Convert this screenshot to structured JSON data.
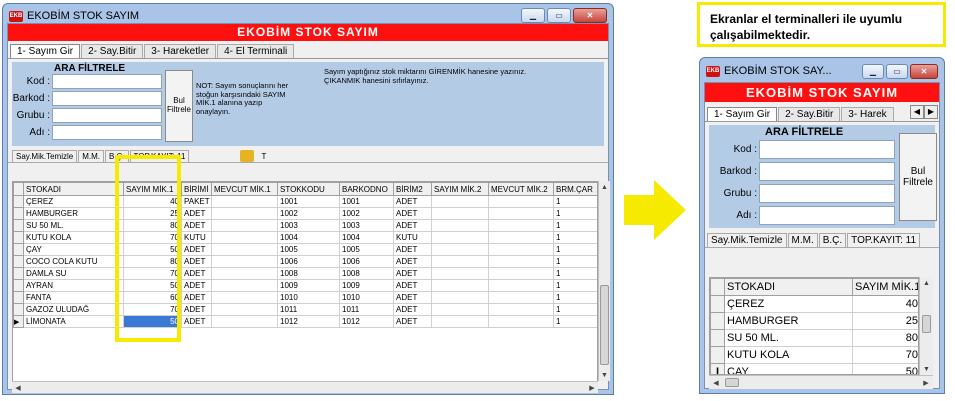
{
  "desktop": {
    "window_title": "EKOBİM STOK SAYIM",
    "app_icon_text": "EKB",
    "banner": "EKOBİM STOK SAYIM",
    "tabs": [
      {
        "label": "1- Sayım Gir"
      },
      {
        "label": "2- Say.Bitir"
      },
      {
        "label": "3- Hareketler"
      },
      {
        "label": "4- El Terminali"
      }
    ],
    "filter": {
      "title": "ARA FİLTRELE",
      "fields": [
        {
          "label": "Kod :",
          "value": ""
        },
        {
          "label": "Barkod :",
          "value": ""
        },
        {
          "label": "Grubu :",
          "value": ""
        },
        {
          "label": "Adı :",
          "value": ""
        }
      ],
      "button_label": "Bul\nFiltrele",
      "note": "NOT: Sayım sonuçlarını her stoğun karşısındaki SAYIM MİK.1 alanına yazıp onaylayın.",
      "info": "Sayım yaptığınız stok miktarını GİRENMİK hanesine yazınız. ÇIKANMIK hanesini sıfırlayınız."
    },
    "status": {
      "clear": "Say.Mik.Temizle",
      "mm": "M.M.",
      "bc": "B.Ç.",
      "total": "TOP.KAYIT: 11",
      "t": "T"
    },
    "columns": [
      "STOKADI",
      "SAYIM MİK.1",
      "BİRİMİ",
      "MEVCUT MİK.1",
      "STOKKODU",
      "BARKODNO",
      "BİRİM2",
      "SAYIM MİK.2",
      "MEVCUT MİK.2",
      "BRM.ÇAR"
    ],
    "rows": [
      {
        "name": "ÇEREZ",
        "qty": "40",
        "unit": "PAKET",
        "stock": "",
        "code": "1001",
        "barcode": "1001",
        "unit2": "ADET",
        "qty2": "",
        "stock2": "",
        "factor": "1"
      },
      {
        "name": "HAMBURGER",
        "qty": "25",
        "unit": "ADET",
        "stock": "",
        "code": "1002",
        "barcode": "1002",
        "unit2": "ADET",
        "qty2": "",
        "stock2": "",
        "factor": "1"
      },
      {
        "name": "SU 50 ML.",
        "qty": "80",
        "unit": "ADET",
        "stock": "",
        "code": "1003",
        "barcode": "1003",
        "unit2": "ADET",
        "qty2": "",
        "stock2": "",
        "factor": "1"
      },
      {
        "name": "KUTU KOLA",
        "qty": "70",
        "unit": "KUTU",
        "stock": "",
        "code": "1004",
        "barcode": "1004",
        "unit2": "KUTU",
        "qty2": "",
        "stock2": "",
        "factor": "1"
      },
      {
        "name": "ÇAY",
        "qty": "50",
        "unit": "ADET",
        "stock": "",
        "code": "1005",
        "barcode": "1005",
        "unit2": "ADET",
        "qty2": "",
        "stock2": "",
        "factor": "1"
      },
      {
        "name": "COCO COLA KUTU",
        "qty": "80",
        "unit": "ADET",
        "stock": "",
        "code": "1006",
        "barcode": "1006",
        "unit2": "ADET",
        "qty2": "",
        "stock2": "",
        "factor": "1"
      },
      {
        "name": "DAMLA SU",
        "qty": "70",
        "unit": "ADET",
        "stock": "",
        "code": "1008",
        "barcode": "1008",
        "unit2": "ADET",
        "qty2": "",
        "stock2": "",
        "factor": "1"
      },
      {
        "name": "AYRAN",
        "qty": "50",
        "unit": "ADET",
        "stock": "",
        "code": "1009",
        "barcode": "1009",
        "unit2": "ADET",
        "qty2": "",
        "stock2": "",
        "factor": "1"
      },
      {
        "name": "FANTA",
        "qty": "60",
        "unit": "ADET",
        "stock": "",
        "code": "1010",
        "barcode": "1010",
        "unit2": "ADET",
        "qty2": "",
        "stock2": "",
        "factor": "1"
      },
      {
        "name": "GAZOZ ULUDAĞ",
        "qty": "70",
        "unit": "ADET",
        "stock": "",
        "code": "1011",
        "barcode": "1011",
        "unit2": "ADET",
        "qty2": "",
        "stock2": "",
        "factor": "1"
      },
      {
        "name": "LİMONATA",
        "qty": "50",
        "unit": "ADET",
        "stock": "",
        "code": "1012",
        "barcode": "1012",
        "unit2": "ADET",
        "qty2": "",
        "stock2": "",
        "factor": "1"
      }
    ]
  },
  "callout": "Ekranlar el terminalleri ile uyumlu çalışabilmektedir.",
  "terminal": {
    "window_title": "EKOBİM STOK SAY...",
    "app_icon_text": "EKB",
    "banner": "EKOBİM STOK SAYIM",
    "tabs": [
      {
        "label": "1- Sayım Gir"
      },
      {
        "label": "2- Say.Bitir"
      },
      {
        "label": "3- Harek"
      }
    ],
    "filter": {
      "title": "ARA FİLTRELE",
      "fields": [
        {
          "label": "Kod :",
          "value": ""
        },
        {
          "label": "Barkod :",
          "value": ""
        },
        {
          "label": "Grubu :",
          "value": ""
        },
        {
          "label": "Adı :",
          "value": ""
        }
      ],
      "button_label": "Bul\nFiltrele"
    },
    "status": {
      "clear": "Say.Mik.Temizle",
      "mm": "M.M.",
      "bc": "B.Ç.",
      "total": "TOP.KAYIT: 11"
    },
    "columns": [
      "STOKADI",
      "SAYIM MİK.1"
    ],
    "rows": [
      {
        "name": "ÇEREZ",
        "qty": "40"
      },
      {
        "name": "HAMBURGER",
        "qty": "25"
      },
      {
        "name": "SU 50 ML.",
        "qty": "80"
      },
      {
        "name": "KUTU KOLA",
        "qty": "70"
      },
      {
        "name": "ÇAY",
        "qty": "50"
      }
    ]
  },
  "colors": {
    "banner": "#ff1010",
    "highlight": "#f5ea00",
    "window_frame": "#a9c4e6",
    "filter_panel": "#b4cbe6",
    "selection": "#3a7ad4"
  }
}
